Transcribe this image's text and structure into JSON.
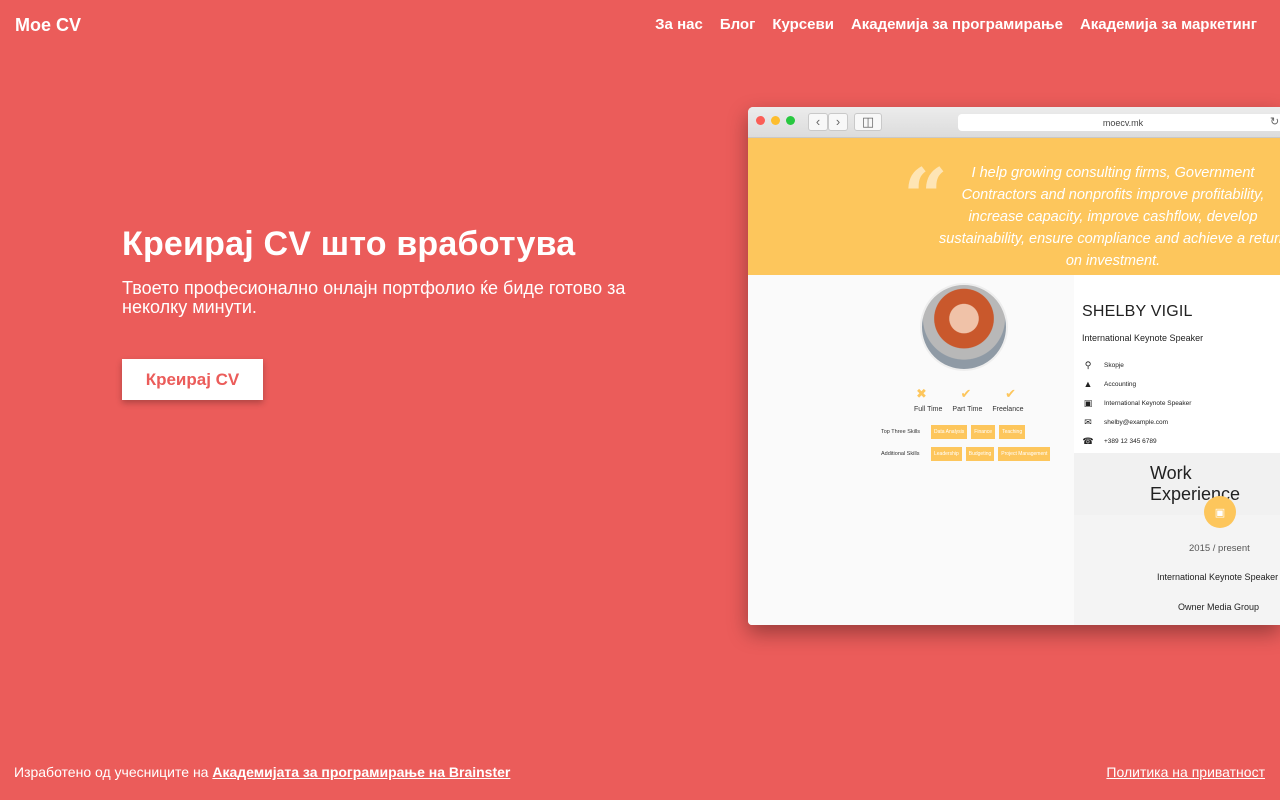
{
  "header": {
    "brand": "Moe CV",
    "nav": [
      "За нас",
      "Блог",
      "Курсеви",
      "Академија за програмирање",
      "Академија за маркетинг"
    ]
  },
  "hero": {
    "title": "Креирај CV што вработува",
    "subtitle": "Твоето професионално онлајн портфолио ќе биде готово за неколку минути.",
    "cta_label": "Креирај CV"
  },
  "preview": {
    "url": "moecv.mk",
    "quote": "I help growing consulting firms, Government Contractors and nonprofits improve profitability, increase capacity, improve cashflow, develop sustainability, ensure compliance and achieve a return on investment.",
    "work_types": [
      "Full Time",
      "Part Time",
      "Freelance"
    ],
    "top_skills_label": "Top Three Skills",
    "top_skills": [
      "Data Analysis",
      "Finance",
      "Teaching"
    ],
    "additional_skills_label": "Additional Skills",
    "additional_skills": [
      "Leadership",
      "Budgeting",
      "Project Management"
    ],
    "name": "SHELBY VIGIL",
    "title": "International Keynote Speaker",
    "info": [
      {
        "icon": "location-icon",
        "text": "Skopje"
      },
      {
        "icon": "graduation-cap-icon",
        "text": "Accounting"
      },
      {
        "icon": "briefcase-icon",
        "text": "International Keynote Speaker"
      },
      {
        "icon": "envelope-icon",
        "text": "shelby@example.com"
      },
      {
        "icon": "phone-icon",
        "text": "+389 12 345 6789"
      }
    ],
    "work_heading": "Work Experience",
    "work_date": "2015 / present",
    "work_role": "International Keynote Speaker",
    "work_org": "Owner Media Group"
  },
  "footer": {
    "credit_prefix": "Изработено од учесниците на",
    "credit_link": "Академијата за програмирање на Brainster",
    "privacy": "Политика на приватност"
  },
  "colors": {
    "background": "#eb5c5a",
    "accent_yellow": "#fdc65c",
    "white": "#ffffff"
  }
}
